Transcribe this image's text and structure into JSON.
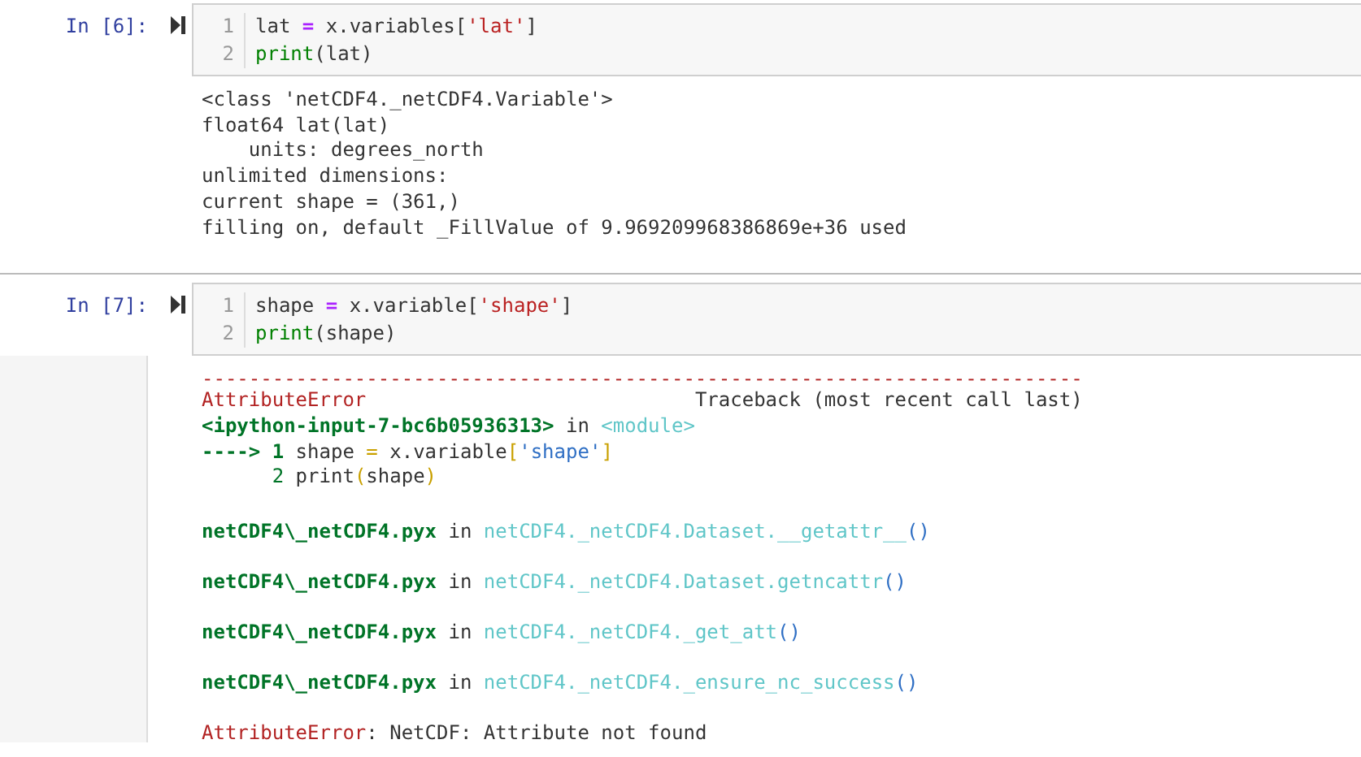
{
  "cells": [
    {
      "prompt": "In [6]:",
      "is_error": false,
      "code_lines": [
        {
          "number": "1",
          "tokens": [
            {
              "text": "lat ",
              "kind": "plain"
            },
            {
              "text": "=",
              "kind": "op"
            },
            {
              "text": " x.variables[",
              "kind": "plain"
            },
            {
              "text": "'lat'",
              "kind": "string"
            },
            {
              "text": "]",
              "kind": "plain"
            }
          ]
        },
        {
          "number": "2",
          "tokens": [
            {
              "text": "print",
              "kind": "builtin"
            },
            {
              "text": "(lat)",
              "kind": "plain"
            }
          ]
        }
      ],
      "output_blocks": [
        [
          {
            "tokens": [
              {
                "text": "<class 'netCDF4._netCDF4.Variable'>",
                "kind": "plain"
              }
            ]
          },
          {
            "tokens": [
              {
                "text": "float64 lat(lat)",
                "kind": "plain"
              }
            ]
          },
          {
            "tokens": [
              {
                "text": "    units: degrees_north",
                "kind": "plain"
              }
            ]
          },
          {
            "tokens": [
              {
                "text": "unlimited dimensions: ",
                "kind": "plain"
              }
            ]
          },
          {
            "tokens": [
              {
                "text": "current shape = (361,)",
                "kind": "plain"
              }
            ]
          },
          {
            "tokens": [
              {
                "text": "filling on, default _FillValue of 9.969209968386869e+36 used",
                "kind": "plain"
              }
            ]
          }
        ]
      ]
    },
    {
      "prompt": "In [7]:",
      "is_error": true,
      "code_lines": [
        {
          "number": "1",
          "tokens": [
            {
              "text": "shape ",
              "kind": "plain"
            },
            {
              "text": "=",
              "kind": "op"
            },
            {
              "text": " x.variable[",
              "kind": "plain"
            },
            {
              "text": "'shape'",
              "kind": "string"
            },
            {
              "text": "]",
              "kind": "plain"
            }
          ]
        },
        {
          "number": "2",
          "tokens": [
            {
              "text": "print",
              "kind": "builtin"
            },
            {
              "text": "(shape)",
              "kind": "plain"
            }
          ]
        }
      ],
      "output_blocks": [
        [
          {
            "tokens": [
              {
                "text": "---------------------------------------------------------------------------",
                "kind": "tb-red"
              }
            ]
          },
          {
            "tokens": [
              {
                "text": "AttributeError",
                "kind": "tb-red"
              },
              {
                "text": "                            Traceback (most recent call last)",
                "kind": "plain"
              }
            ]
          },
          {
            "tokens": [
              {
                "text": "<ipython-input-7-bc6b05936313>",
                "kind": "tb-green-bold"
              },
              {
                "text": " in ",
                "kind": "plain"
              },
              {
                "text": "<module>",
                "kind": "tb-cyan"
              }
            ]
          },
          {
            "tokens": [
              {
                "text": "----> 1",
                "kind": "tb-green-bold"
              },
              {
                "text": " shape ",
                "kind": "plain"
              },
              {
                "text": "=",
                "kind": "tb-yellow"
              },
              {
                "text": " x.variable",
                "kind": "plain"
              },
              {
                "text": "[",
                "kind": "tb-yellow"
              },
              {
                "text": "'shape'",
                "kind": "tb-blue"
              },
              {
                "text": "]",
                "kind": "tb-yellow"
              }
            ]
          },
          {
            "tokens": [
              {
                "text": "      2",
                "kind": "tb-green"
              },
              {
                "text": " print",
                "kind": "plain"
              },
              {
                "text": "(",
                "kind": "tb-yellow"
              },
              {
                "text": "shape",
                "kind": "plain"
              },
              {
                "text": ")",
                "kind": "tb-yellow"
              }
            ]
          }
        ],
        [
          {
            "tokens": [
              {
                "text": "netCDF4\\_netCDF4.pyx",
                "kind": "tb-green-bold"
              },
              {
                "text": " in ",
                "kind": "plain"
              },
              {
                "text": "netCDF4._netCDF4.Dataset.__getattr__",
                "kind": "tb-cyan"
              },
              {
                "text": "()",
                "kind": "tb-blue"
              }
            ]
          }
        ],
        [
          {
            "tokens": [
              {
                "text": "netCDF4\\_netCDF4.pyx",
                "kind": "tb-green-bold"
              },
              {
                "text": " in ",
                "kind": "plain"
              },
              {
                "text": "netCDF4._netCDF4.Dataset.getncattr",
                "kind": "tb-cyan"
              },
              {
                "text": "()",
                "kind": "tb-blue"
              }
            ]
          }
        ],
        [
          {
            "tokens": [
              {
                "text": "netCDF4\\_netCDF4.pyx",
                "kind": "tb-green-bold"
              },
              {
                "text": " in ",
                "kind": "plain"
              },
              {
                "text": "netCDF4._netCDF4._get_att",
                "kind": "tb-cyan"
              },
              {
                "text": "()",
                "kind": "tb-blue"
              }
            ]
          }
        ],
        [
          {
            "tokens": [
              {
                "text": "netCDF4\\_netCDF4.pyx",
                "kind": "tb-green-bold"
              },
              {
                "text": " in ",
                "kind": "plain"
              },
              {
                "text": "netCDF4._netCDF4._ensure_nc_success",
                "kind": "tb-cyan"
              },
              {
                "text": "()",
                "kind": "tb-blue"
              }
            ]
          }
        ],
        [
          {
            "tokens": [
              {
                "text": "AttributeError",
                "kind": "tb-red"
              },
              {
                "text": ": NetCDF: Attribute not found",
                "kind": "plain"
              }
            ]
          }
        ]
      ]
    }
  ]
}
